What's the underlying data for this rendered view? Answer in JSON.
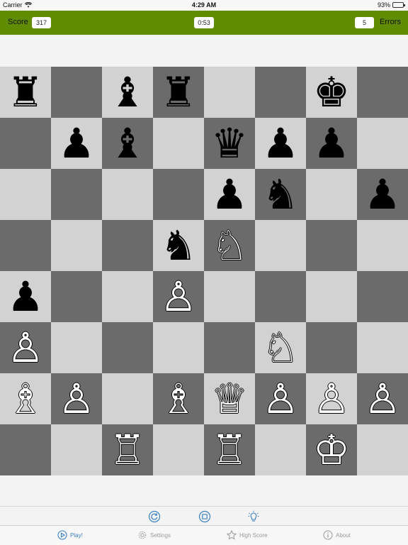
{
  "status_bar": {
    "carrier": "Carrier",
    "time": "4:29 AM",
    "battery": "93%",
    "battery_level": 0.93
  },
  "header": {
    "score_label": "Score",
    "score": "317",
    "timer": "0:53",
    "errors": "5",
    "errors_label": "Errors"
  },
  "board": {
    "ranks": [
      [
        {
          "p": "♜",
          "c": "b"
        },
        {
          "p": "",
          "c": ""
        },
        {
          "p": "♝",
          "c": "b"
        },
        {
          "p": "♜",
          "c": "b"
        },
        {
          "p": "",
          "c": ""
        },
        {
          "p": "",
          "c": ""
        },
        {
          "p": "♚",
          "c": "b"
        },
        {
          "p": "",
          "c": ""
        }
      ],
      [
        {
          "p": "",
          "c": ""
        },
        {
          "p": "♟",
          "c": "b"
        },
        {
          "p": "♝",
          "c": "b"
        },
        {
          "p": "",
          "c": ""
        },
        {
          "p": "♛",
          "c": "b"
        },
        {
          "p": "♟",
          "c": "b"
        },
        {
          "p": "♟",
          "c": "b"
        },
        {
          "p": "",
          "c": ""
        }
      ],
      [
        {
          "p": "",
          "c": ""
        },
        {
          "p": "",
          "c": ""
        },
        {
          "p": "",
          "c": ""
        },
        {
          "p": "",
          "c": ""
        },
        {
          "p": "♟",
          "c": "b"
        },
        {
          "p": "♞",
          "c": "b"
        },
        {
          "p": "",
          "c": ""
        },
        {
          "p": "♟",
          "c": "b"
        }
      ],
      [
        {
          "p": "",
          "c": ""
        },
        {
          "p": "",
          "c": ""
        },
        {
          "p": "",
          "c": ""
        },
        {
          "p": "♞",
          "c": "b"
        },
        {
          "p": "♘",
          "c": "w"
        },
        {
          "p": "",
          "c": ""
        },
        {
          "p": "",
          "c": ""
        },
        {
          "p": "",
          "c": ""
        }
      ],
      [
        {
          "p": "♟",
          "c": "b"
        },
        {
          "p": "",
          "c": ""
        },
        {
          "p": "",
          "c": ""
        },
        {
          "p": "♙",
          "c": "w"
        },
        {
          "p": "",
          "c": ""
        },
        {
          "p": "",
          "c": ""
        },
        {
          "p": "",
          "c": ""
        },
        {
          "p": "",
          "c": ""
        }
      ],
      [
        {
          "p": "♙",
          "c": "w"
        },
        {
          "p": "",
          "c": ""
        },
        {
          "p": "",
          "c": ""
        },
        {
          "p": "",
          "c": ""
        },
        {
          "p": "",
          "c": ""
        },
        {
          "p": "♘",
          "c": "w"
        },
        {
          "p": "",
          "c": ""
        },
        {
          "p": "",
          "c": ""
        }
      ],
      [
        {
          "p": "♗",
          "c": "w"
        },
        {
          "p": "♙",
          "c": "w"
        },
        {
          "p": "",
          "c": ""
        },
        {
          "p": "♗",
          "c": "w"
        },
        {
          "p": "♕",
          "c": "w"
        },
        {
          "p": "♙",
          "c": "w"
        },
        {
          "p": "♙",
          "c": "w"
        },
        {
          "p": "♙",
          "c": "w"
        }
      ],
      [
        {
          "p": "",
          "c": ""
        },
        {
          "p": "",
          "c": ""
        },
        {
          "p": "♖",
          "c": "w"
        },
        {
          "p": "",
          "c": ""
        },
        {
          "p": "♖",
          "c": "w"
        },
        {
          "p": "",
          "c": ""
        },
        {
          "p": "♔",
          "c": "w"
        },
        {
          "p": "",
          "c": ""
        }
      ]
    ]
  },
  "controls": [
    {
      "name": "restart-icon"
    },
    {
      "name": "stop-icon"
    },
    {
      "name": "hint-bulb-icon"
    }
  ],
  "tabs": [
    {
      "label": "Play!",
      "icon": "play-icon",
      "active": true
    },
    {
      "label": "Settings",
      "icon": "gear-icon",
      "active": false
    },
    {
      "label": "High Score",
      "icon": "star-icon",
      "active": false
    },
    {
      "label": "About",
      "icon": "info-icon",
      "active": false
    }
  ],
  "colors": {
    "header_green": "#5f8c00",
    "dark_square": "#6b6b6b",
    "light_square": "#d2d2d2",
    "accent": "#3a7fc1"
  }
}
